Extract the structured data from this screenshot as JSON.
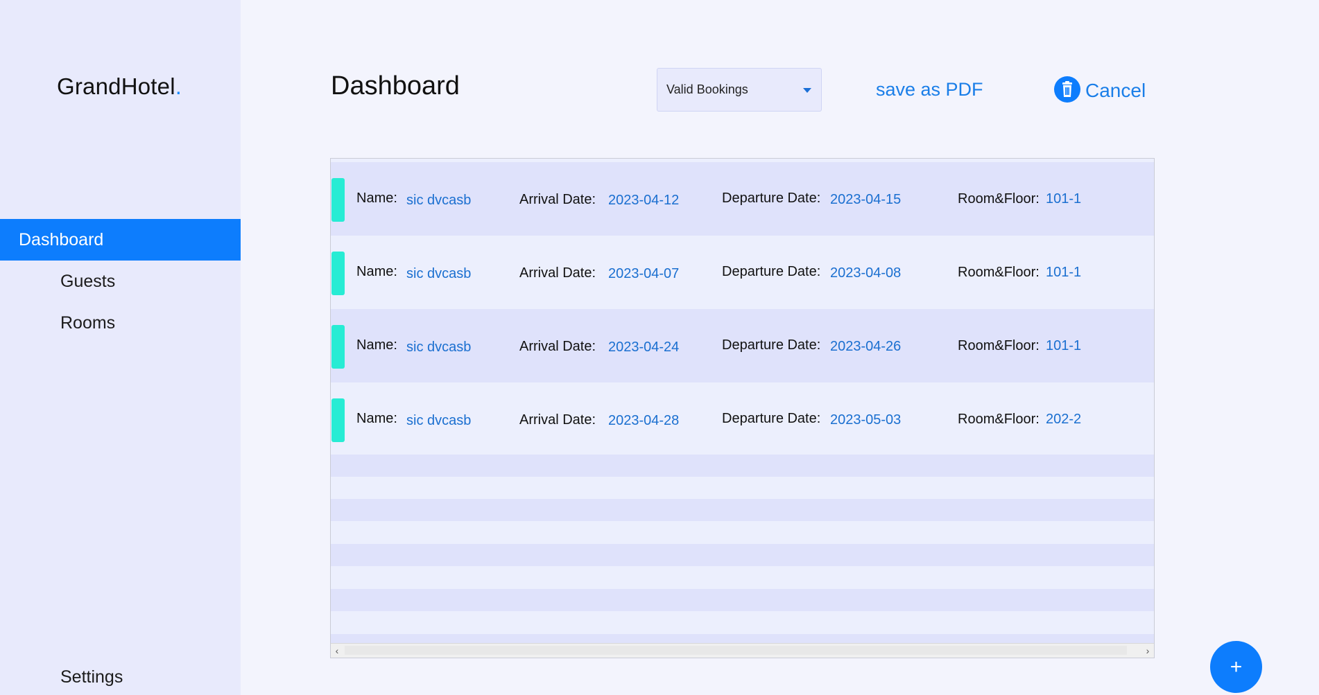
{
  "brand": {
    "name": "GrandHotel",
    "dot": "."
  },
  "nav": {
    "dashboard": "Dashboard",
    "guests": "Guests",
    "rooms": "Rooms",
    "settings": "Settings"
  },
  "header": {
    "title": "Dashboard",
    "filter_selected": "Valid Bookings",
    "save_pdf": "save as PDF",
    "cancel": "Cancel"
  },
  "labels": {
    "name": "Name:",
    "arrival": "Arrival Date:",
    "departure": "Departure Date:",
    "room": "Room&Floor:"
  },
  "bookings": [
    {
      "name": "sic dvcasb",
      "arrival": "2023-04-12",
      "departure": "2023-04-15",
      "room": "101-1"
    },
    {
      "name": "sic dvcasb",
      "arrival": "2023-04-07",
      "departure": "2023-04-08",
      "room": "101-1"
    },
    {
      "name": "sic dvcasb",
      "arrival": "2023-04-24",
      "departure": "2023-04-26",
      "room": "101-1"
    },
    {
      "name": "sic dvcasb",
      "arrival": "2023-04-28",
      "departure": "2023-05-03",
      "room": "202-2"
    }
  ],
  "fab": {
    "label": "+"
  },
  "icons": {
    "trash": "trash-icon",
    "caret": "chevron-down-icon",
    "scroll_left": "chevron-left-icon",
    "scroll_right": "chevron-right-icon",
    "add": "plus-icon"
  },
  "colors": {
    "accent": "#0d7dfd",
    "marker": "#27ecd4",
    "value_text": "#1a6fd0"
  }
}
